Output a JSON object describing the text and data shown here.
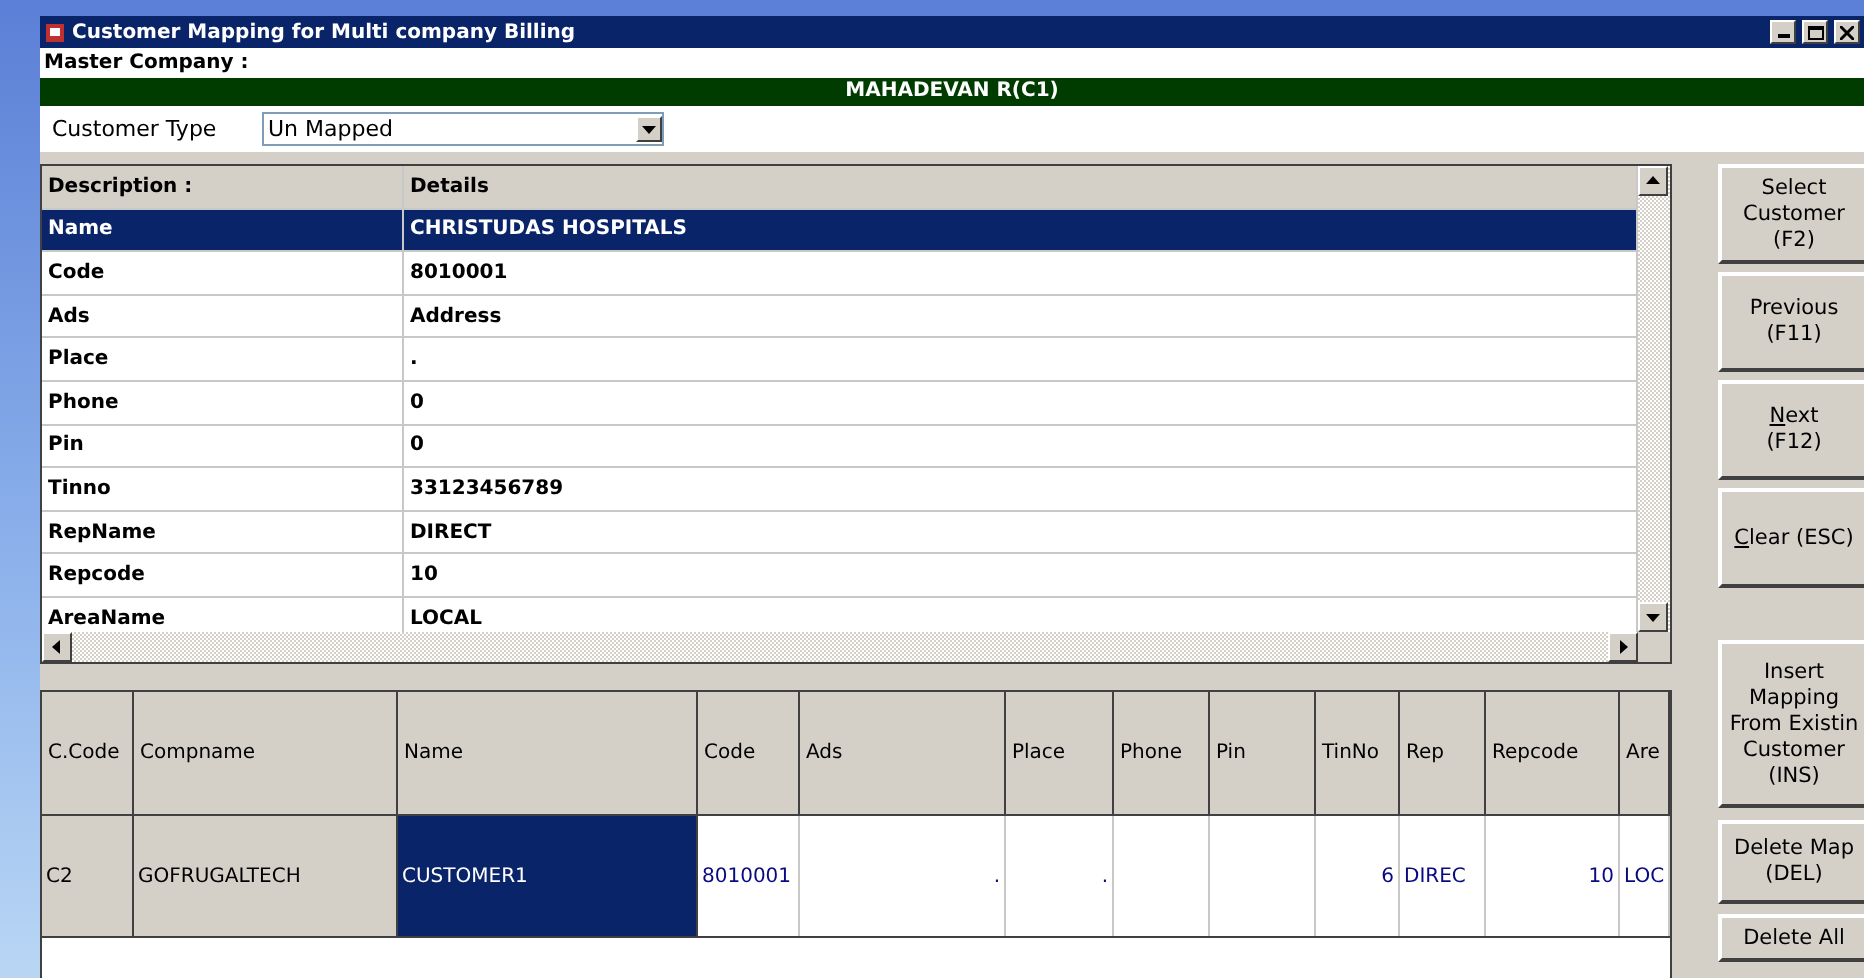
{
  "window": {
    "title": "Customer Mapping  for Multi company Billing"
  },
  "master_company": {
    "label": "Master Company :",
    "banner": "MAHADEVAN R(C1)"
  },
  "customer_type": {
    "label": "Customer Type",
    "value": "Un Mapped"
  },
  "details": {
    "columns": [
      "Description :",
      "Details"
    ],
    "rows": [
      {
        "field": "Name",
        "value": "CHRISTUDAS HOSPITALS",
        "selected": true
      },
      {
        "field": "Code",
        "value": "8010001",
        "selected": false
      },
      {
        "field": "Ads",
        "value": "Address",
        "selected": false
      },
      {
        "field": "Place",
        "value": ".",
        "selected": false
      },
      {
        "field": "Phone",
        "value": "0",
        "selected": false
      },
      {
        "field": "Pin",
        "value": "0",
        "selected": false
      },
      {
        "field": "Tinno",
        "value": "33123456789",
        "selected": false
      },
      {
        "field": "RepName",
        "value": "DIRECT",
        "selected": false
      },
      {
        "field": "Repcode",
        "value": "10",
        "selected": false
      },
      {
        "field": "AreaName",
        "value": "LOCAL",
        "selected": false
      }
    ]
  },
  "mapping": {
    "columns": [
      "C.Code",
      "Compname",
      "Name",
      "Code",
      "Ads",
      "Place",
      "Phone",
      "Pin",
      "TinNo",
      "Rep",
      "Repcode",
      "Are"
    ],
    "rows": [
      {
        "cells": [
          {
            "text": "C2",
            "selected": false
          },
          {
            "text": "GOFRUGALTECH",
            "selected": false
          },
          {
            "text": "CUSTOMER1",
            "selected": true
          },
          {
            "text": "8010001",
            "selected": false
          },
          {
            "text": ".",
            "selected": false
          },
          {
            "text": ".",
            "selected": false
          },
          {
            "text": "",
            "selected": false
          },
          {
            "text": "",
            "selected": false
          },
          {
            "text": "6",
            "selected": false
          },
          {
            "text": "DIREC",
            "selected": false
          },
          {
            "text": "10",
            "selected": false
          },
          {
            "text": "LOC",
            "selected": false
          }
        ]
      }
    ]
  },
  "buttons": [
    {
      "lines": [
        "Select",
        "Customer",
        "(F2)"
      ]
    },
    {
      "lines": [
        "Previous",
        "(F11)"
      ]
    },
    {
      "lines": [
        "Next",
        "(F12)"
      ],
      "underline_first": true
    },
    {
      "lines": [
        "Clear  (ESC)"
      ],
      "underline_first": true
    },
    {
      "lines": [
        "Insert",
        "Mapping",
        "From Existin",
        "Customer",
        "(INS)"
      ]
    },
    {
      "lines": [
        "Delete Map",
        "(DEL)"
      ]
    },
    {
      "lines": [
        "Delete All"
      ]
    }
  ]
}
